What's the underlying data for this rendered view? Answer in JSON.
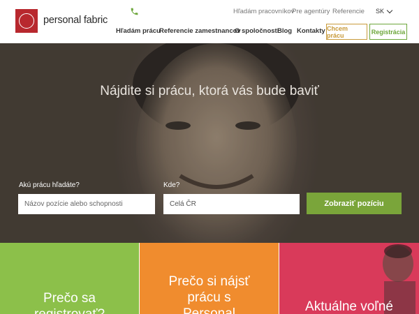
{
  "header": {
    "logo_text": "personal fabric",
    "top_links": [
      "Hľadám pracovníkov",
      "Pre agentúry",
      "Referencie"
    ],
    "language": "SK",
    "nav": [
      "Hľadám prácu",
      "Referencie zamestnancov",
      "O spoločnosti",
      "Blog",
      "Kontakty"
    ],
    "cta_job": "Chcem prácu",
    "cta_register": "Registrácia"
  },
  "hero": {
    "title": "Nájdite si prácu, ktorá vás bude baviť",
    "what_label": "Akú prácu hľadáte?",
    "what_placeholder": "Názov pozície alebo schopnosti",
    "where_label": "Kde?",
    "where_value": "Celá ČR",
    "search_button": "Zobraziť pozíciu"
  },
  "tiles": [
    {
      "text_line1": "Prečo sa",
      "text_line2": "registrovať?",
      "color": "#8cc04a"
    },
    {
      "text_line1": "Prečo si nájsť",
      "text_line2": "prácu s",
      "text_line3": "Personal",
      "color": "#f08c2e"
    },
    {
      "text_line1": "Aktuálne voľné",
      "color": "#d93a5a"
    }
  ],
  "colors": {
    "brand": "#b8282e",
    "accent_green": "#7aa53a",
    "accent_gold": "#c89a3a"
  }
}
